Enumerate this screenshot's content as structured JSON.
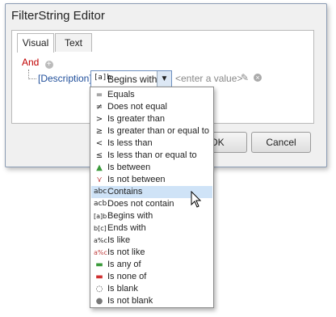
{
  "dialog": {
    "title": "FilterString Editor",
    "tabs": [
      {
        "label": "Visual"
      },
      {
        "label": "Text"
      }
    ],
    "group_operator": "And",
    "condition": {
      "field": "[Description]",
      "operator_icon": "[a]b",
      "operator": "Begins with",
      "value_placeholder": "<enter a value>"
    },
    "buttons": {
      "ok": "OK",
      "cancel": "Cancel"
    }
  },
  "dropdown": {
    "hovered": "Contains",
    "items": [
      {
        "icon": "=",
        "label": "Equals"
      },
      {
        "icon": "≠",
        "label": "Does not equal"
      },
      {
        "icon": ">",
        "label": "Is greater than"
      },
      {
        "icon": "≥",
        "label": "Is greater than or equal to"
      },
      {
        "icon": "<",
        "label": "Is less than"
      },
      {
        "icon": "≤",
        "label": "Is less than or equal to"
      },
      {
        "icon": "▲",
        "label": "Is between"
      },
      {
        "icon": "⋎",
        "label": "Is not between"
      },
      {
        "icon": "abc",
        "label": "Contains"
      },
      {
        "icon": "acb",
        "label": "Does not contain"
      },
      {
        "icon": "[a]b",
        "label": "Begins with"
      },
      {
        "icon": "b[c]",
        "label": "Ends with"
      },
      {
        "icon": "a%c",
        "label": "Is like"
      },
      {
        "icon": "a%c",
        "label": "Is not like"
      },
      {
        "icon": "▬",
        "label": "Is any of"
      },
      {
        "icon": "▬",
        "label": "Is none of"
      },
      {
        "icon": "◌",
        "label": "Is blank"
      },
      {
        "icon": "●",
        "label": "Is not blank"
      }
    ]
  },
  "colors": {
    "and": "#c00000",
    "field": "#1f4e9a",
    "hover": "#cfe3f7"
  }
}
